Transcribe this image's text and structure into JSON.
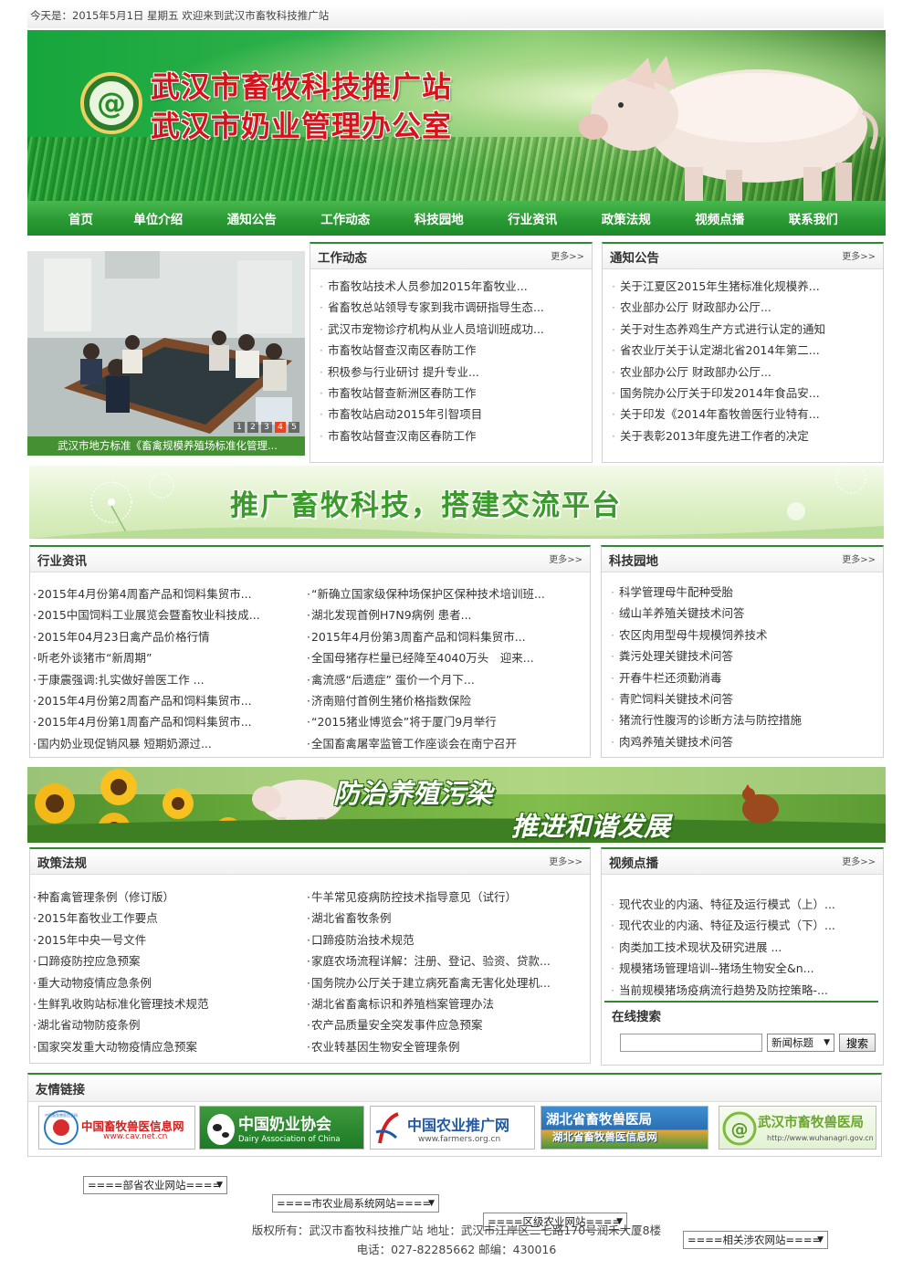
{
  "topbar": {
    "text": "今天是：2015年5月1日 星期五   欢迎来到武汉市畜牧科技推广站"
  },
  "header": {
    "title_line1": "武汉市畜牧科技推广站",
    "title_line2": "武汉市奶业管理办公室"
  },
  "nav": {
    "items": [
      "首页",
      "单位介绍",
      "通知公告",
      "工作动态",
      "科技园地",
      "行业资讯",
      "政策法规",
      "视频点播",
      "联系我们"
    ]
  },
  "slideshow": {
    "caption": "武汉市地方标准《畜禽规模养殖场标准化管理...",
    "dots": [
      "1",
      "2",
      "3",
      "4",
      "5"
    ],
    "active_dot": 1
  },
  "more_label": "更多>>",
  "work_news": {
    "title": "工作动态",
    "items": [
      "市畜牧站技术人员参加2015年畜牧业...",
      "省畜牧总站领导专家到我市调研指导生态...",
      "武汉市宠物诊疗机构从业人员培训班成功...",
      "市畜牧站督查汉南区春防工作",
      "积极参与行业研讨 提升专业...",
      "市畜牧站督查新洲区春防工作",
      "市畜牧站启动2015年引智项目",
      "市畜牧站督查汉南区春防工作"
    ]
  },
  "notices": {
    "title": "通知公告",
    "items": [
      "关于江夏区2015年生猪标准化规模养...",
      "农业部办公厅 财政部办公厅...",
      "关于对生态养鸡生产方式进行认定的通知",
      "省农业厅关于认定湖北省2014年第二...",
      "农业部办公厅 财政部办公厅...",
      "国务院办公厅关于印发2014年食品安...",
      "关于印发《2014年畜牧兽医行业特有...",
      "关于表彰2013年度先进工作者的决定"
    ]
  },
  "banner_slogan": "推广畜牧科技，搭建交流平台",
  "industry_news": {
    "title": "行业资讯",
    "left": [
      "2015年4月份第4周畜产品和饲料集贸市...",
      "2015中国饲料工业展览会暨畜牧业科技成...",
      "2015年04月23日禽产品价格行情",
      "听老外谈猪市“新周期”",
      "于康震强调:扎实做好兽医工作 ...",
      "2015年4月份第2周畜产品和饲料集贸市...",
      "2015年4月份第1周畜产品和饲料集贸市...",
      "国内奶业现促销风暴 短期奶源过..."
    ],
    "right": [
      "“新确立国家级保种场保护区保种技术培训班...",
      "湖北发现首例H7N9病例 患者...",
      "2015年4月份第3周畜产品和饲料集贸市...",
      "全国母猪存栏量已经降至4040万头　迎来...",
      "禽流感“后遗症” 蛋价一个月下...",
      "济南赔付首例生猪价格指数保险",
      "“2015猪业博览会”将于厦门9月举行",
      "全国畜禽屠宰监管工作座谈会在南宁召开"
    ]
  },
  "tech_garden": {
    "title": "科技园地",
    "items": [
      "科学管理母牛配种受胎",
      "绒山羊养殖关键技术问答",
      "农区肉用型母牛规模饲养技术",
      "粪污处理关键技术问答",
      "开春牛栏还须勤消毒",
      "青贮饲料关键技术问答",
      "猪流行性腹泻的诊断方法与防控措施",
      "肉鸡养殖关键技术问答"
    ]
  },
  "banner3": {
    "line1": "防治养殖污染",
    "line2": "推进和谐发展"
  },
  "policy": {
    "title": "政策法规",
    "left": [
      "种畜禽管理条例（修订版）",
      "2015年畜牧业工作要点",
      "2015年中央一号文件",
      "口蹄疫防控应急预案",
      "重大动物疫情应急条例",
      "生鲜乳收购站标准化管理技术规范",
      "湖北省动物防疫条例",
      "国家突发重大动物疫情应急预案"
    ],
    "right": [
      "牛羊常见疫病防控技术指导意见（试行）",
      "湖北省畜牧条例",
      "口蹄疫防治技术规范",
      "家庭农场流程详解：注册、登记、验资、贷款...",
      "国务院办公厅关于建立病死畜禽无害化处理机...",
      "湖北省畜禽标识和养殖档案管理办法",
      "农产品质量安全突发事件应急预案",
      "农业转基因生物安全管理条例"
    ]
  },
  "videos": {
    "title": "视频点播",
    "items": [
      "现代农业的内涵、特征及运行模式（上）...",
      "现代农业的内涵、特征及运行模式（下）...",
      "肉类加工技术现状及研究进展 ...",
      "规模猪场管理培训--猪场生物安全&n...",
      "当前规模猪场疫病流行趋势及防控策略-..."
    ]
  },
  "search": {
    "title": "在线搜索",
    "input_value": "",
    "select_value": "新闻标题",
    "button_label": "搜索"
  },
  "links": {
    "title": "友情链接",
    "logos": [
      {
        "name": "中国畜牧兽医信息网",
        "sub": "www.cav.net.cn",
        "seal_text": "中国畜牧兽医信息网"
      },
      {
        "name": "中国奶业协会",
        "sub": "Dairy Association of China"
      },
      {
        "name": "中国农业推广网",
        "sub": "www.farmers.org.cn"
      },
      {
        "name": "湖北省畜牧兽医局",
        "sub": "湖北省畜牧兽医信息网"
      },
      {
        "name": "武汉市畜牧兽医局",
        "sub": "http://www.wuhanagri.gov.cn"
      }
    ]
  },
  "site_selects": [
    "====部省农业网站====",
    "====市农业局系统网站====",
    "====区级农业网站====",
    "====相关涉农网站===="
  ],
  "footer": {
    "line1": "版权所有：武汉市畜牧科技推广站 地址：武汉市江岸区二七路170号润禾大厦8楼",
    "line2": "电话：027-82285662 邮编：430016"
  },
  "colors": {
    "brand_green": "#2a9a34",
    "title_red": "#d6121a",
    "border_green": "#2f8a2f"
  }
}
